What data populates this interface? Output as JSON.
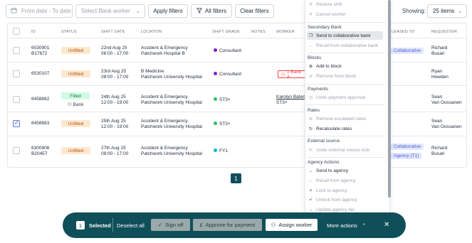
{
  "filters": {
    "date_placeholder": "From date - To date",
    "worker_placeholder": "Select Bank worker",
    "apply": "Apply filters",
    "all": "All filters",
    "clear": "Clear filters",
    "showing_label": "Showing:",
    "page_size": "25 items"
  },
  "table": {
    "headers": [
      "ID",
      "STATUS",
      "SHIFT DATE",
      "LOCATION",
      "SHIFT GRADE",
      "NOTES",
      "WORKER",
      "LEASED TO",
      "REQUESTER"
    ],
    "rows": [
      {
        "id": "6030901",
        "id2": "B17672",
        "status": "Unfilled",
        "date": "22nd Aug 25",
        "time": "08:00 - 17:00",
        "loc1": "Accident & Emergency",
        "loc2": "Patchwork Hospital B",
        "grade": "Consultant",
        "grade_color": "#7e22ce",
        "leased": "Collaborative",
        "req1": "Richard",
        "req2": "Busari"
      },
      {
        "id": "6530107",
        "id2": "",
        "status": "Unfilled",
        "date": "23rd Aug 25",
        "time": "08:00 - 17:00",
        "loc1": "B Medicine",
        "loc2": "Patchwork University Hospital",
        "grade": "Consultant",
        "grade_color": "#7e22ce",
        "worker_pill": "1 Bank A",
        "req1": "Ryan",
        "req2": "Howden"
      },
      {
        "id": "6458882",
        "id2": "",
        "status": "Filled",
        "status_sub": "Bank",
        "date": "24th Aug 25",
        "time": "12:00 - 19:00",
        "loc1": "Accident & Emergency",
        "loc2": "Patchwork University Hospital",
        "grade": "ST3+",
        "grade_color": "#22c55e",
        "worker1": "Karolyn Batem",
        "worker2": "ST3+",
        "req1": "Sean",
        "req2": "Van Oossanen"
      },
      {
        "id": "6458883",
        "id2": "",
        "status": "Unfilled",
        "date": "25th Aug 25",
        "time": "12:00 - 19:00",
        "loc1": "Accident & Emergency",
        "loc2": "Patchwork University Hospital",
        "grade": "ST3+",
        "grade_color": "#22c55e",
        "req1": "Sean",
        "req2": "Van Oossanen"
      },
      {
        "id": "6300906",
        "id2": "B20457",
        "status": "Unfilled",
        "date": "27th Aug 25",
        "time": "08:00 - 17:00",
        "loc1": "Accident & Emergency",
        "loc2": "Patchwork University Hospital",
        "grade": "FY1",
        "grade_color": "#06b6d4",
        "leased": "Collaborative",
        "leased2": "Agency (T1)",
        "req1": "Richard",
        "req2": "Busari"
      }
    ]
  },
  "pagination": {
    "current": "1"
  },
  "menu": {
    "items_top": [
      {
        "label": "Restore shift",
        "enabled": false,
        "icon": "↺"
      },
      {
        "label": "Cancel worker",
        "enabled": false,
        "icon": "✕"
      }
    ],
    "secondary_bank": "Secondary Bank",
    "send_collab": "Send to collaborative bank",
    "recall_collab": "Recall from collaborative bank",
    "blocks": "Blocks",
    "add_block": "Add to block",
    "remove_block": "Remove from block",
    "payments": "Payments",
    "undo_payment": "Undo payment approval",
    "rates": "Rates",
    "remove_rates": "Remove escalated rates",
    "recalc_rates": "Recalculate rates",
    "external_source": "External source",
    "undo_external": "Undo external source lock",
    "agency_actions": "Agency Actions",
    "send_agency": "Send to agency",
    "recall_agency": "Recall from agency",
    "lock_agency": "Lock to agency",
    "unlock_agency": "Unlock from agency",
    "update_tier": "Update agency tier"
  },
  "actionbar": {
    "count": "1",
    "selected": "Selected",
    "deselect": "Deselect all",
    "signoff": "Sign off",
    "approve": "Approve for payment",
    "assign": "Assign worker",
    "more": "More actions"
  },
  "colors": {
    "primary": "#0f4f5a",
    "unfilled_bg": "#fde8cf",
    "filled_bg": "#d1fae5"
  }
}
